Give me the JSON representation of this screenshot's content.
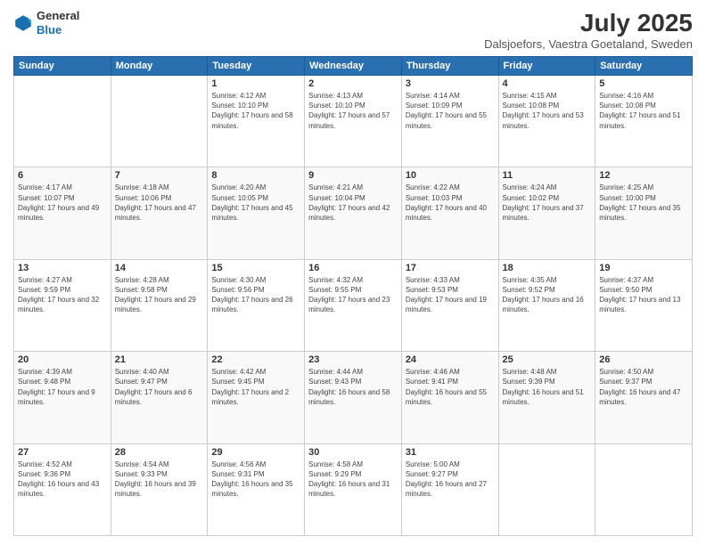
{
  "header": {
    "logo_line1": "General",
    "logo_line2": "Blue",
    "title": "July 2025",
    "location": "Dalsjoefors, Vaestra Goetaland, Sweden"
  },
  "columns": [
    "Sunday",
    "Monday",
    "Tuesday",
    "Wednesday",
    "Thursday",
    "Friday",
    "Saturday"
  ],
  "weeks": [
    [
      {
        "day": "",
        "detail": ""
      },
      {
        "day": "",
        "detail": ""
      },
      {
        "day": "1",
        "detail": "Sunrise: 4:12 AM\nSunset: 10:10 PM\nDaylight: 17 hours and 58 minutes."
      },
      {
        "day": "2",
        "detail": "Sunrise: 4:13 AM\nSunset: 10:10 PM\nDaylight: 17 hours and 57 minutes."
      },
      {
        "day": "3",
        "detail": "Sunrise: 4:14 AM\nSunset: 10:09 PM\nDaylight: 17 hours and 55 minutes."
      },
      {
        "day": "4",
        "detail": "Sunrise: 4:15 AM\nSunset: 10:08 PM\nDaylight: 17 hours and 53 minutes."
      },
      {
        "day": "5",
        "detail": "Sunrise: 4:16 AM\nSunset: 10:08 PM\nDaylight: 17 hours and 51 minutes."
      }
    ],
    [
      {
        "day": "6",
        "detail": "Sunrise: 4:17 AM\nSunset: 10:07 PM\nDaylight: 17 hours and 49 minutes."
      },
      {
        "day": "7",
        "detail": "Sunrise: 4:18 AM\nSunset: 10:06 PM\nDaylight: 17 hours and 47 minutes."
      },
      {
        "day": "8",
        "detail": "Sunrise: 4:20 AM\nSunset: 10:05 PM\nDaylight: 17 hours and 45 minutes."
      },
      {
        "day": "9",
        "detail": "Sunrise: 4:21 AM\nSunset: 10:04 PM\nDaylight: 17 hours and 42 minutes."
      },
      {
        "day": "10",
        "detail": "Sunrise: 4:22 AM\nSunset: 10:03 PM\nDaylight: 17 hours and 40 minutes."
      },
      {
        "day": "11",
        "detail": "Sunrise: 4:24 AM\nSunset: 10:02 PM\nDaylight: 17 hours and 37 minutes."
      },
      {
        "day": "12",
        "detail": "Sunrise: 4:25 AM\nSunset: 10:00 PM\nDaylight: 17 hours and 35 minutes."
      }
    ],
    [
      {
        "day": "13",
        "detail": "Sunrise: 4:27 AM\nSunset: 9:59 PM\nDaylight: 17 hours and 32 minutes."
      },
      {
        "day": "14",
        "detail": "Sunrise: 4:28 AM\nSunset: 9:58 PM\nDaylight: 17 hours and 29 minutes."
      },
      {
        "day": "15",
        "detail": "Sunrise: 4:30 AM\nSunset: 9:56 PM\nDaylight: 17 hours and 26 minutes."
      },
      {
        "day": "16",
        "detail": "Sunrise: 4:32 AM\nSunset: 9:55 PM\nDaylight: 17 hours and 23 minutes."
      },
      {
        "day": "17",
        "detail": "Sunrise: 4:33 AM\nSunset: 9:53 PM\nDaylight: 17 hours and 19 minutes."
      },
      {
        "day": "18",
        "detail": "Sunrise: 4:35 AM\nSunset: 9:52 PM\nDaylight: 17 hours and 16 minutes."
      },
      {
        "day": "19",
        "detail": "Sunrise: 4:37 AM\nSunset: 9:50 PM\nDaylight: 17 hours and 13 minutes."
      }
    ],
    [
      {
        "day": "20",
        "detail": "Sunrise: 4:39 AM\nSunset: 9:48 PM\nDaylight: 17 hours and 9 minutes."
      },
      {
        "day": "21",
        "detail": "Sunrise: 4:40 AM\nSunset: 9:47 PM\nDaylight: 17 hours and 6 minutes."
      },
      {
        "day": "22",
        "detail": "Sunrise: 4:42 AM\nSunset: 9:45 PM\nDaylight: 17 hours and 2 minutes."
      },
      {
        "day": "23",
        "detail": "Sunrise: 4:44 AM\nSunset: 9:43 PM\nDaylight: 16 hours and 58 minutes."
      },
      {
        "day": "24",
        "detail": "Sunrise: 4:46 AM\nSunset: 9:41 PM\nDaylight: 16 hours and 55 minutes."
      },
      {
        "day": "25",
        "detail": "Sunrise: 4:48 AM\nSunset: 9:39 PM\nDaylight: 16 hours and 51 minutes."
      },
      {
        "day": "26",
        "detail": "Sunrise: 4:50 AM\nSunset: 9:37 PM\nDaylight: 16 hours and 47 minutes."
      }
    ],
    [
      {
        "day": "27",
        "detail": "Sunrise: 4:52 AM\nSunset: 9:36 PM\nDaylight: 16 hours and 43 minutes."
      },
      {
        "day": "28",
        "detail": "Sunrise: 4:54 AM\nSunset: 9:33 PM\nDaylight: 16 hours and 39 minutes."
      },
      {
        "day": "29",
        "detail": "Sunrise: 4:56 AM\nSunset: 9:31 PM\nDaylight: 16 hours and 35 minutes."
      },
      {
        "day": "30",
        "detail": "Sunrise: 4:58 AM\nSunset: 9:29 PM\nDaylight: 16 hours and 31 minutes."
      },
      {
        "day": "31",
        "detail": "Sunrise: 5:00 AM\nSunset: 9:27 PM\nDaylight: 16 hours and 27 minutes."
      },
      {
        "day": "",
        "detail": ""
      },
      {
        "day": "",
        "detail": ""
      }
    ]
  ]
}
